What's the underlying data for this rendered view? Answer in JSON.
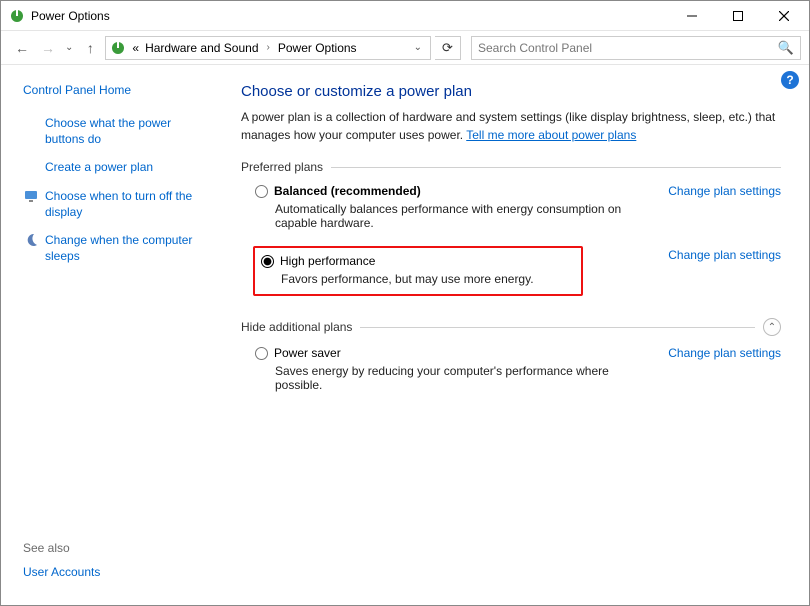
{
  "window": {
    "title": "Power Options"
  },
  "breadcrumb": {
    "prefix": "«",
    "items": [
      "Hardware and Sound",
      "Power Options"
    ]
  },
  "search": {
    "placeholder": "Search Control Panel"
  },
  "sidebar": {
    "home": "Control Panel Home",
    "items": [
      {
        "label": "Choose what the power buttons do",
        "icon": null
      },
      {
        "label": "Create a power plan",
        "icon": null
      },
      {
        "label": "Choose when to turn off the display",
        "icon": "monitor"
      },
      {
        "label": "Change when the computer sleeps",
        "icon": "moon"
      }
    ],
    "see_also_label": "See also",
    "see_also_items": [
      "User Accounts"
    ]
  },
  "main": {
    "heading": "Choose or customize a power plan",
    "intro_a": "A power plan is a collection of hardware and system settings (like display brightness, sleep, etc.) that manages how your computer uses power. ",
    "intro_link": "Tell me more about power plans",
    "preferred_label": "Preferred plans",
    "hide_label": "Hide additional plans",
    "change_link": "Change plan settings",
    "plans_preferred": [
      {
        "name": "Balanced (recommended)",
        "desc": "Automatically balances performance with energy consumption on capable hardware.",
        "selected": false,
        "bold": true,
        "highlight": false
      },
      {
        "name": "High performance",
        "desc": "Favors performance, but may use more energy.",
        "selected": true,
        "bold": false,
        "highlight": true
      }
    ],
    "plans_additional": [
      {
        "name": "Power saver",
        "desc": "Saves energy by reducing your computer's performance where possible.",
        "selected": false,
        "bold": false
      }
    ]
  }
}
